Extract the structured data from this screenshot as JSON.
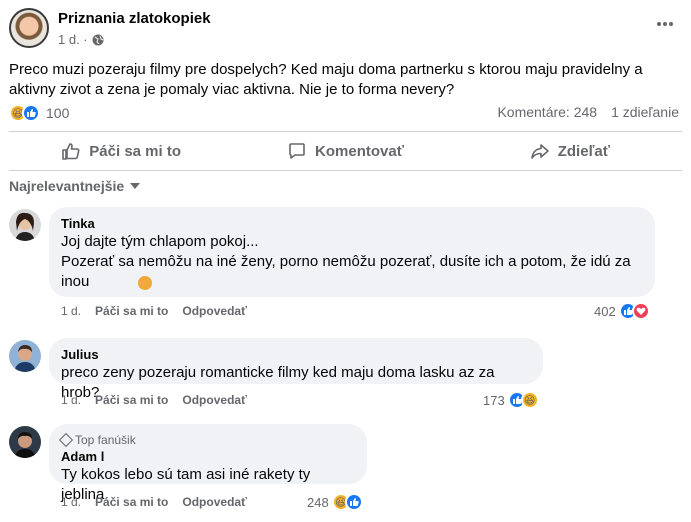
{
  "post": {
    "page_name": "Priznania zlatokopiek",
    "time": "1 d. ·",
    "text": "Preco muzi pozeraju filmy pre dospelych? Ked maju doma partnerku s ktorou maju pravidelny a aktivny zivot a zena je pomaly viac aktivna. Nie je to forma nevery?",
    "reaction_count": "100",
    "comments_label": "Komentáre: 248",
    "shares_label": "1 zdieľanie"
  },
  "actions": {
    "like": "Páči sa mi to",
    "comment": "Komentovať",
    "share": "Zdieľať"
  },
  "sort_label": "Najrelevantnejšie",
  "comments": [
    {
      "author": "Tinka",
      "text": "Joj dajte tým chlapom pokoj...\nPozerať sa nemôžu na iné ženy, porno nemôžu pozerať, dusíte ich a potom, že idú za inou",
      "time": "1 d.",
      "like": "Páči sa mi to",
      "reply": "Odpovedať",
      "count": "402"
    },
    {
      "author": "Julius",
      "text": "preco zeny pozeraju romanticke filmy ked maju doma lasku az za hrob?",
      "time": "1 d.",
      "like": "Páči sa mi to",
      "reply": "Odpovedať",
      "count": "173"
    },
    {
      "badge": "Top fanúšik",
      "author": "Adam l",
      "text": "Ty kokos lebo sú tam asi iné rakety ty jeblina",
      "time": "1 d.",
      "like": "Páči sa mi to",
      "reply": "Odpovedať",
      "count": "248"
    }
  ],
  "colors": {
    "like": "#1877f2",
    "love": "#f33e58",
    "haha": "#f7b125",
    "muted": "#65676b",
    "bubble": "#f0f2f5"
  }
}
